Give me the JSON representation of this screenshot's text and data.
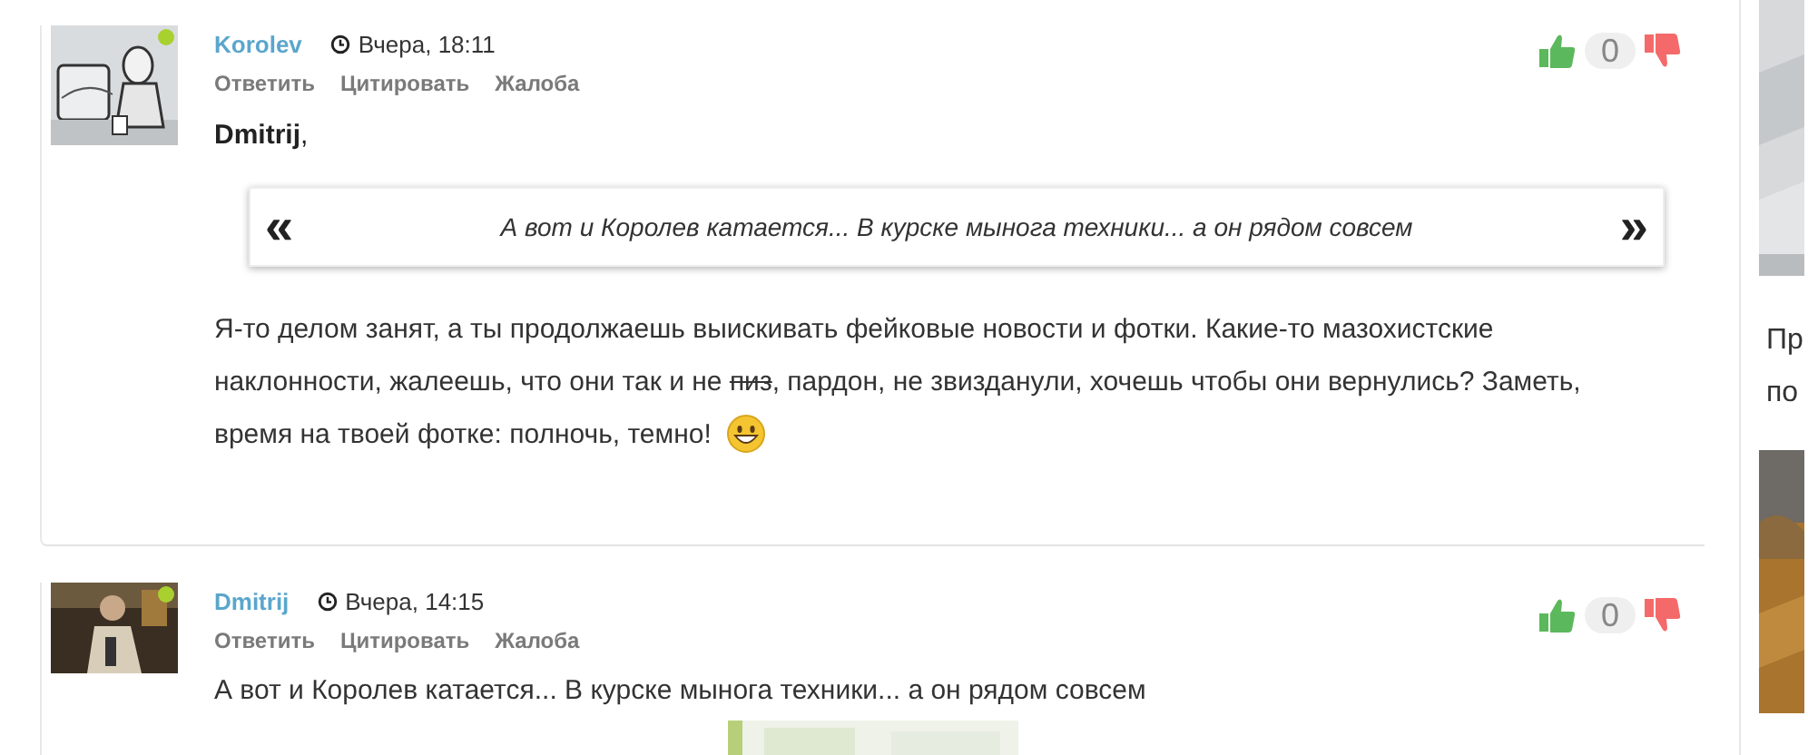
{
  "comments": [
    {
      "author": "Korolev",
      "time": "Вчера, 18:11",
      "online": true,
      "actions": [
        "Ответить",
        "Цитировать",
        "Жалоба"
      ],
      "votes": "0",
      "addressee": "Dmitrij",
      "addressee_suffix": ",",
      "quote": "А вот и Королев катается... В курске мынога техники... а он рядом совсем",
      "quote_open": "«",
      "quote_close": "»",
      "body": [
        {
          "kind": "text",
          "text": "Я-то делом занят, а ты продолжаешь выискивать фейковые новости и фотки. Какие-то мазохистские наклонности, жалеешь, что они так и не "
        },
        {
          "kind": "struck",
          "text": "пиз"
        },
        {
          "kind": "text",
          "text": ", пардон, не звизданули,  хочешь чтобы они вернулись? Заметь, время на твоей фотке: полночь, темно!"
        },
        {
          "kind": "emoji"
        }
      ]
    },
    {
      "author": "Dmitrij",
      "time": "Вчера, 14:15",
      "online": true,
      "actions": [
        "Ответить",
        "Цитировать",
        "Жалоба"
      ],
      "votes": "0",
      "body": [
        {
          "kind": "text",
          "text": "А вот и Королев катается... В курске мынога техники... а он рядом совсем"
        }
      ],
      "attachment": {
        "kind": "picture"
      }
    }
  ],
  "sidebar": {
    "items": [
      {
        "kind": "picture"
      },
      {
        "kind": "text",
        "lines": [
          "Пр",
          "по"
        ]
      },
      {
        "kind": "picture"
      }
    ]
  }
}
